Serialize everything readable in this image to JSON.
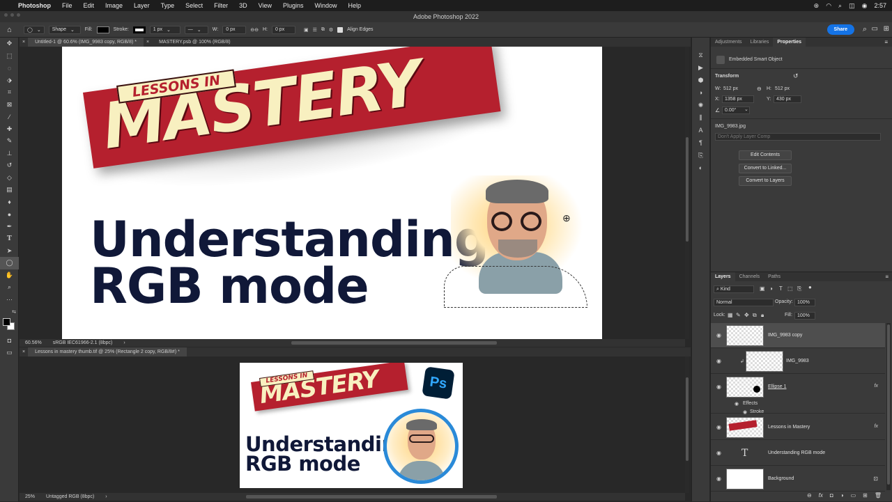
{
  "menubar": {
    "app": "Photoshop",
    "items": [
      "File",
      "Edit",
      "Image",
      "Layer",
      "Type",
      "Select",
      "Filter",
      "3D",
      "View",
      "Plugins",
      "Window",
      "Help"
    ],
    "clock": "2:57"
  },
  "titlebar": {
    "title": "Adobe Photoshop 2022"
  },
  "options": {
    "shape_mode": "Shape",
    "fill_label": "Fill:",
    "stroke_label": "Stroke:",
    "stroke_width": "1 px",
    "w_label": "W:",
    "w_value": "0 px",
    "h_label": "H:",
    "h_value": "0 px",
    "align_edges": "Align Edges",
    "share": "Share",
    "fill_color": "#000000"
  },
  "doc1": {
    "tab_active": "Untitled-1 @ 60.6% (IMG_9983 copy, RGB/8) *",
    "tab_other": "MASTERY.psb @ 100% (RGB/8)",
    "zoom": "60.56%",
    "profile": "sRGB IEC61966-2.1 (8bpc)"
  },
  "doc2": {
    "tab": "Lessons in mastery thumb.tif @ 25% (Rectangle 2 copy, RGB/8#) *",
    "zoom": "25%",
    "profile": "Untagged RGB (8bpc)"
  },
  "artwork": {
    "lessons": "LESSONS IN",
    "mastery": "MASTERY",
    "line1": "Understanding",
    "line2": "RGB mode",
    "ps_badge": "Ps"
  },
  "panels": {
    "top_tabs": [
      "Adjustments",
      "Libraries",
      "Properties"
    ],
    "smart_object": "Embedded Smart Object",
    "transform": "Transform",
    "w_label": "W:",
    "w_value": "512 px",
    "h_label": "H:",
    "h_value": "512 px",
    "x_label": "X:",
    "x_value": "1358 px",
    "y_label": "Y:",
    "y_value": "430 px",
    "angle_value": "0.00°",
    "file_name": "IMG_9983.jpg",
    "layer_comp_placeholder": "Don't Apply Layer Comp",
    "btn_edit": "Edit Contents",
    "btn_linked": "Convert to Linked...",
    "btn_layers": "Convert to Layers"
  },
  "layers": {
    "tabs": [
      "Layers",
      "Channels",
      "Paths"
    ],
    "kind": "Kind",
    "blend": "Normal",
    "opacity_label": "Opacity:",
    "opacity": "100%",
    "lock_label": "Lock:",
    "fill_label": "Fill:",
    "fill": "100%",
    "rows": [
      {
        "name": "IMG_9983 copy"
      },
      {
        "name": "IMG_9983"
      },
      {
        "name": "Ellipse 1",
        "fx": "fx"
      },
      {
        "name": "Lessons in Mastery",
        "fx": "fx"
      },
      {
        "name": "Understanding  RGB mode"
      },
      {
        "name": "Background"
      }
    ],
    "effects": "Effects",
    "stroke": "Stroke"
  },
  "colors": {
    "accent": "#1473e6",
    "banner_red": "#b5202e",
    "banner_cream": "#f8f0c0",
    "headline_navy": "#101838"
  }
}
